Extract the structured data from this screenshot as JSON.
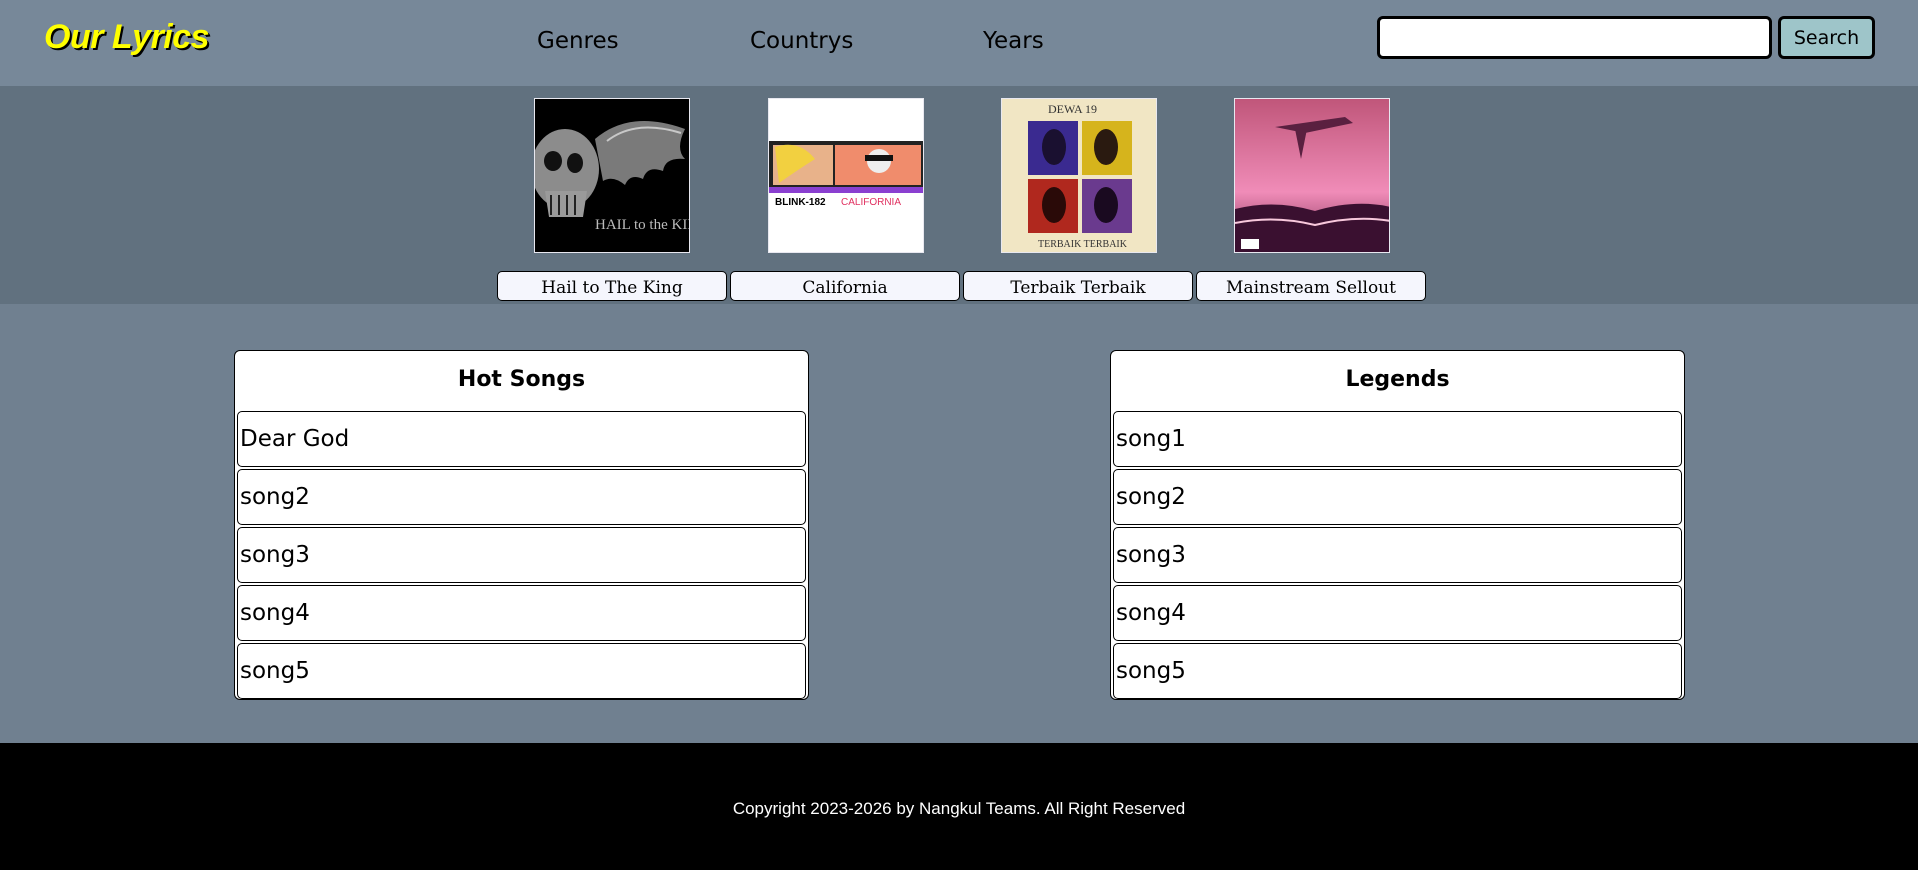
{
  "header": {
    "logo": "Our Lyrics",
    "nav": [
      "Genres",
      "Countrys",
      "Years"
    ],
    "search": {
      "value": "",
      "placeholder": "",
      "button_label": "Search"
    }
  },
  "albums": [
    {
      "title": "Hail to The King"
    },
    {
      "title": "California"
    },
    {
      "title": "Terbaik Terbaik"
    },
    {
      "title": "Mainstream Sellout"
    }
  ],
  "cover_text": {
    "hail": "HAIL to the KING",
    "blink": "BLINK-182",
    "blink_accent": "CALIFORNIA",
    "dewa_top": "DEWA 19",
    "dewa_bottom": "TERBAIK TERBAIK"
  },
  "hot_songs": {
    "title": "Hot Songs",
    "items": [
      "Dear God",
      "song2",
      "song3",
      "song4",
      "song5"
    ]
  },
  "legends": {
    "title": "Legends",
    "items": [
      "song1",
      "song2",
      "song3",
      "song4",
      "song5"
    ]
  },
  "footer": {
    "copyright": "Copyright 2023-2026 by Nangkul Teams. All Right Reserved"
  },
  "colors": {
    "logo": "#ffff00",
    "header_bg": "#778899",
    "albums_bg": "#61717f",
    "body_bg": "#708090",
    "search_button": "#9ec5c9",
    "footer_bg": "#000000"
  }
}
